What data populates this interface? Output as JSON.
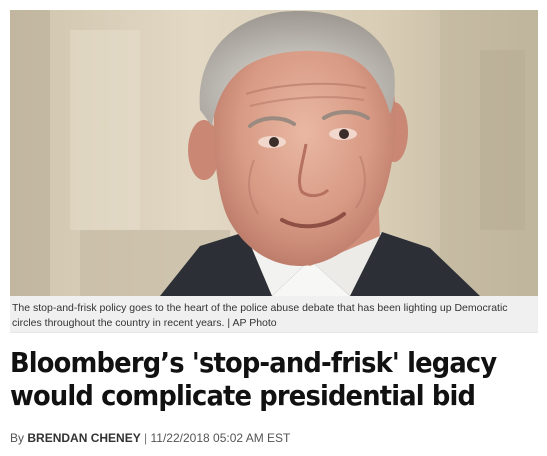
{
  "image": {
    "caption": "The stop-and-frisk policy goes to the heart of the police abuse debate that has been lighting up Democratic circles throughout the country in recent years.",
    "credit": "AP Photo"
  },
  "article": {
    "headline_line1": "Bloomberg’s 'stop-and-frisk' legacy",
    "headline_line2": "would complicate presidential bid",
    "byline_prefix": "By",
    "author": "BRENDAN CHENEY",
    "separator": "|",
    "timestamp": "11/22/2018 05:02 AM EST"
  }
}
